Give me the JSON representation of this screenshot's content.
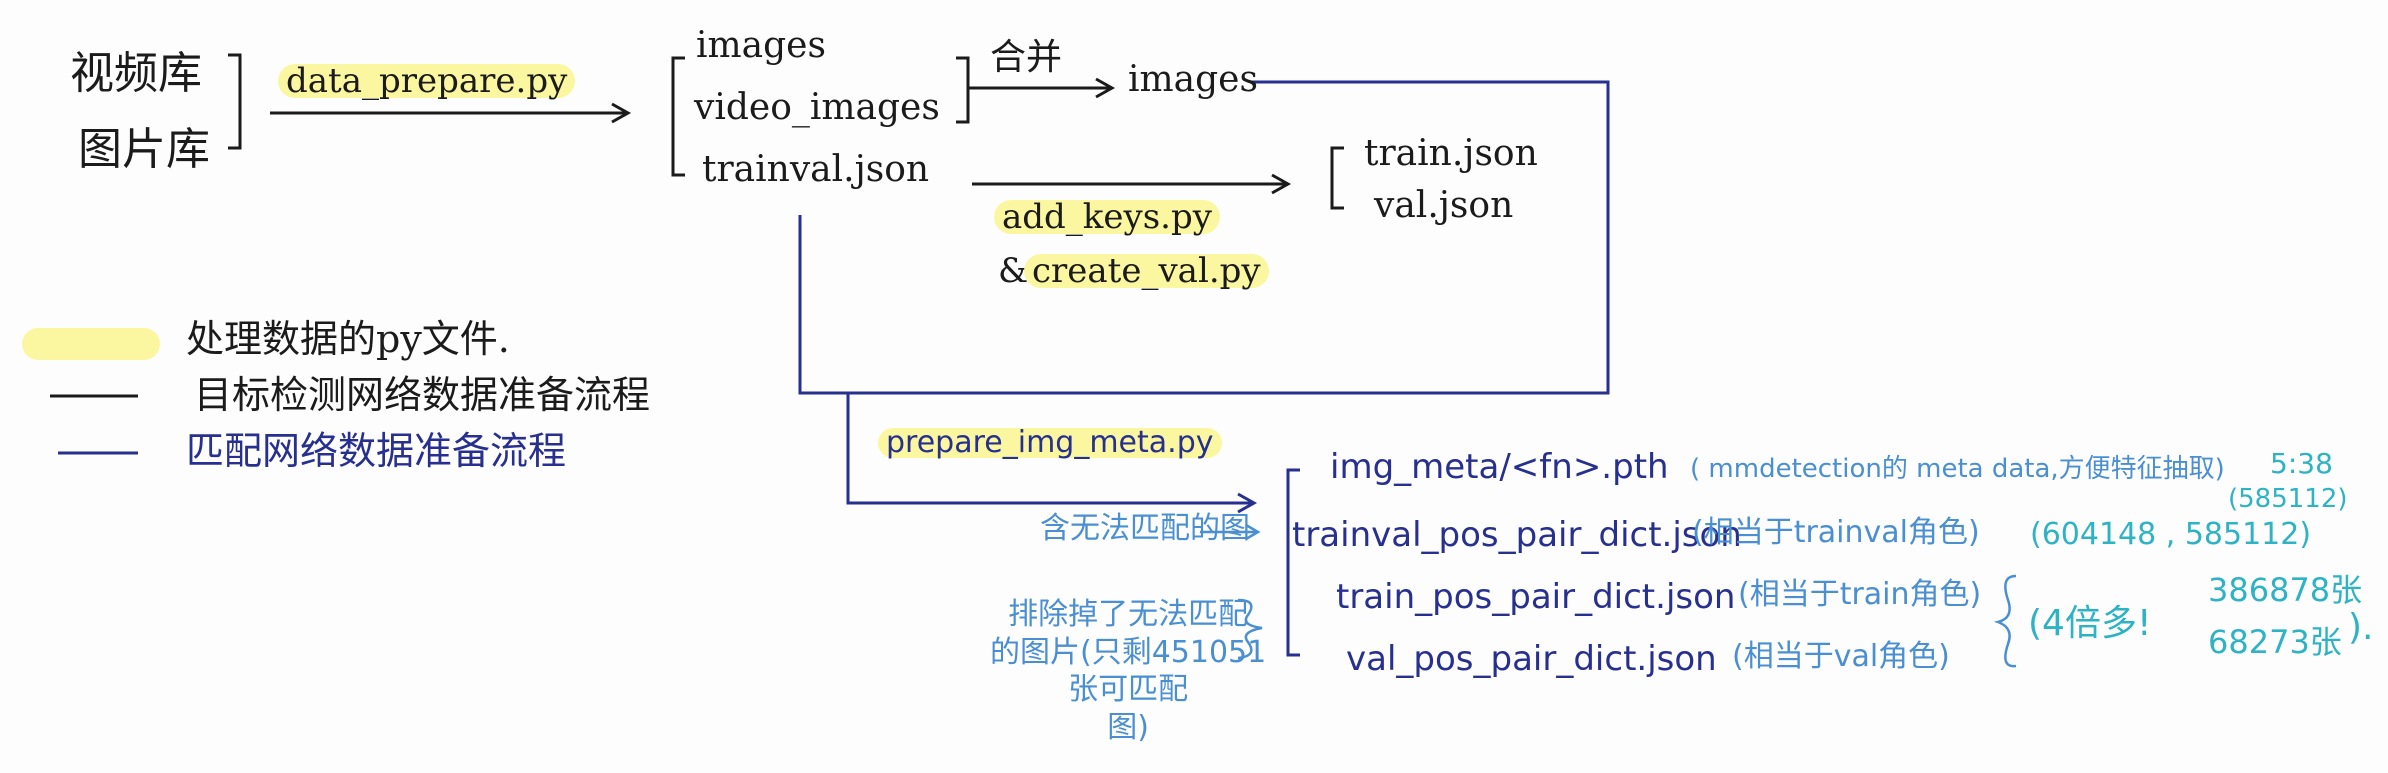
{
  "sources": {
    "line1": "视频库",
    "line2": "图片库"
  },
  "scripts": {
    "data_prepare": "data_prepare.py",
    "add_keys": "add_keys.py",
    "create_val": "create_val.py",
    "create_val_prefix": "&",
    "prepare_img_meta": "prepare_img_meta.py"
  },
  "stage1": {
    "items": [
      "images",
      "video_images",
      "trainval.json"
    ]
  },
  "merge": {
    "label": "合并",
    "result": "images"
  },
  "split": {
    "items": [
      "train.json",
      "val.json"
    ]
  },
  "legend": {
    "items": [
      {
        "label": "处理数据的py文件.",
        "color": "#fbf7a0"
      },
      {
        "label": "目标检测网络数据准备流程",
        "color": "#1b1b1b"
      },
      {
        "label": "匹配网络数据准备流程",
        "color": "#27308f"
      }
    ]
  },
  "outputs": [
    {
      "file": "img_meta/<fn>.pth",
      "note": "( mmdetection的 meta data,方便特征抽取)",
      "count": "5:38",
      "count2": "(585112)"
    },
    {
      "file": "trainval_pos_pair_dict.json",
      "note": "(相当于trainval角色)",
      "count": "(604148 , 585112)"
    },
    {
      "file": "train_pos_pair_dict.json",
      "note": "(相当于train角色)"
    },
    {
      "file": "val_pos_pair_dict.json",
      "note": "(相当于val角色)"
    }
  ],
  "annotations": {
    "include_unmatched": "含无法匹配的图",
    "exclude_unmatched": "排除掉了无法匹配\n的图片(只剩451051\n张可匹配\n图)",
    "four_digit": "(4倍多!",
    "count_a": "386878张",
    "count_b": "68273张",
    "close": ")."
  },
  "colors": {
    "black": "#1b1b1b",
    "navy": "#27308f",
    "light_blue": "#4a8fd1",
    "teal": "#2db3c4",
    "highlight": "#fbf7a0"
  }
}
